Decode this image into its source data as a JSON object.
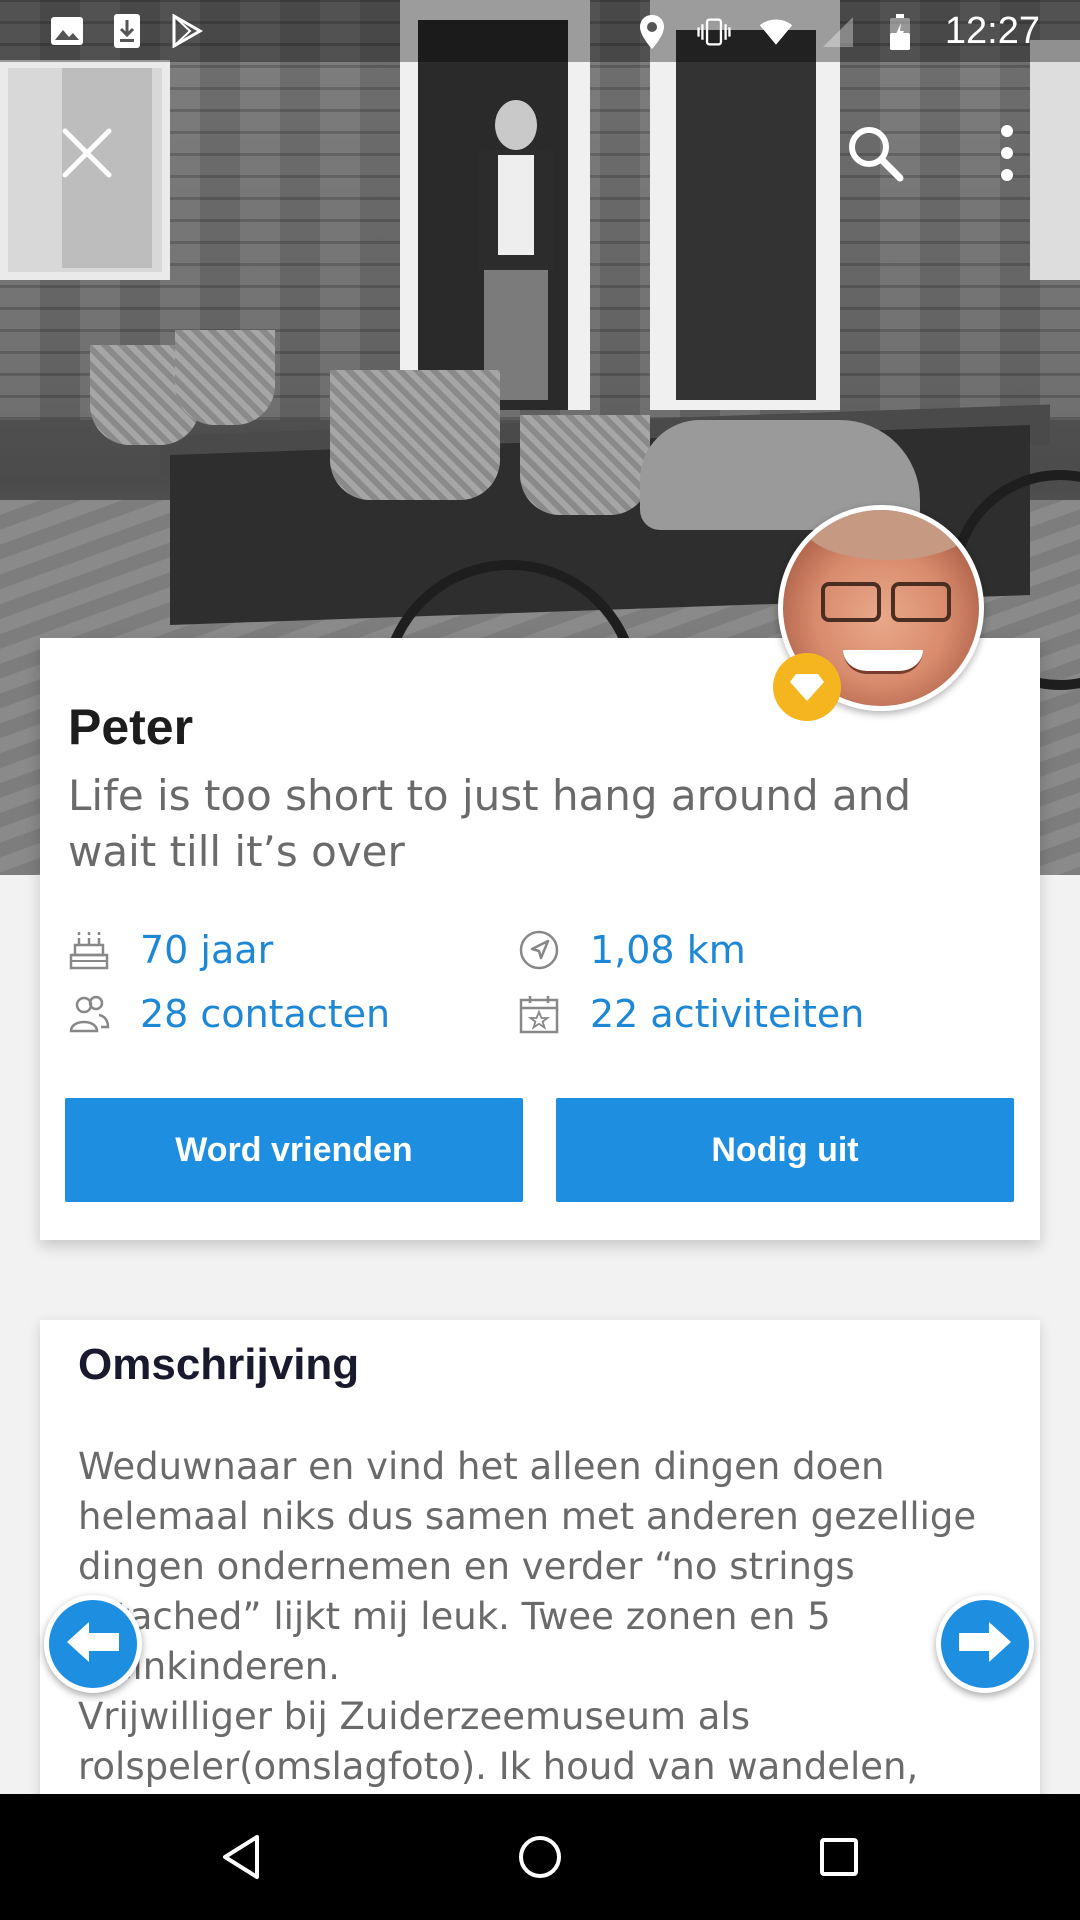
{
  "status_bar": {
    "time": "12:27",
    "left_icons": [
      "image-icon",
      "download-icon",
      "play-store-icon"
    ],
    "right_icons": [
      "location-icon",
      "vibrate-icon",
      "wifi-icon",
      "signal-icon",
      "battery-icon"
    ]
  },
  "top_actions": {
    "close_icon": "close-icon",
    "search_icon": "search-icon",
    "more_icon": "more-vert-icon"
  },
  "profile": {
    "name": "Peter",
    "tagline": "Life is too short to just hang around and wait till it’s over",
    "stats": {
      "age": "70 jaar",
      "distance": "1,08 km",
      "contacts": "28 contacten",
      "activities": "22 activiteiten"
    },
    "buttons": {
      "befriend": "Word vrienden",
      "invite": "Nodig uit"
    },
    "badge_icon": "diamond-icon"
  },
  "description": {
    "title": "Omschrijving",
    "body": "Weduwnaar en vind het alleen dingen doen\nhelemaal niks dus samen met anderen gezellige\ndingen ondernemen en verder “no strings\nattached” lijkt mij leuk. Twee zonen en 5\nkleinkinderen.\nVrijwilliger bij Zuiderzeemuseum als\nrolspeler(omslagfoto). Ik houd van wandelen, geen"
  },
  "colors": {
    "accent": "#1e8ee0",
    "badge": "#f5b51f",
    "name": "#1d1d1d",
    "muted_text": "#6a6a6a"
  },
  "nav_bar": [
    "back-icon",
    "home-icon",
    "recents-icon"
  ]
}
